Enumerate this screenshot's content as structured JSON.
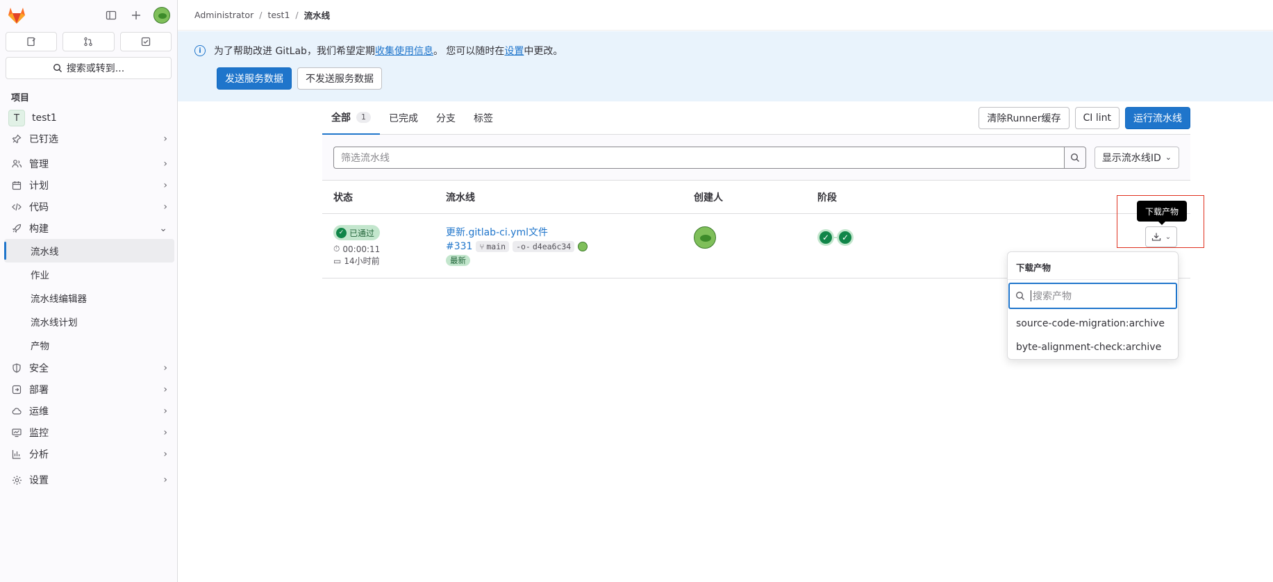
{
  "breadcrumb": [
    "Administrator",
    "test1",
    "流水线"
  ],
  "sidebar": {
    "search_label": "搜索或转到...",
    "section_title": "项目",
    "project_initial": "T",
    "project_name": "test1",
    "items": [
      {
        "label": "已钉选",
        "icon": "pin-icon"
      },
      {
        "label": "管理",
        "icon": "manage-icon"
      },
      {
        "label": "计划",
        "icon": "plan-icon"
      },
      {
        "label": "代码",
        "icon": "code-icon"
      },
      {
        "label": "构建",
        "icon": "rocket-icon"
      }
    ],
    "build_subitems": [
      "流水线",
      "作业",
      "流水线编辑器",
      "流水线计划",
      "产物"
    ],
    "items_after": [
      {
        "label": "安全",
        "icon": "shield-icon"
      },
      {
        "label": "部署",
        "icon": "deploy-icon"
      },
      {
        "label": "运维",
        "icon": "cloud-icon"
      },
      {
        "label": "监控",
        "icon": "monitor-icon"
      },
      {
        "label": "分析",
        "icon": "chart-icon"
      }
    ],
    "settings_label": "设置"
  },
  "banner": {
    "text_before": "为了帮助改进 GitLab，我们希望定期",
    "link1": "收集使用信息",
    "text_mid": "。 您可以随时在",
    "link2": "设置",
    "text_after": "中更改。",
    "send_button": "发送服务数据",
    "dont_send_button": "不发送服务数据"
  },
  "tabs": [
    {
      "label": "全部",
      "count": "1"
    },
    {
      "label": "已完成"
    },
    {
      "label": "分支"
    },
    {
      "label": "标签"
    }
  ],
  "actions": {
    "clear_cache": "清除Runner缓存",
    "ci_lint": "CI lint",
    "run_pipeline": "运行流水线"
  },
  "filter": {
    "placeholder": "筛选流水线",
    "id_dropdown": "显示流水线ID"
  },
  "table": {
    "headers": [
      "状态",
      "流水线",
      "创建人",
      "阶段"
    ],
    "row": {
      "status": "已通过",
      "duration": "00:00:11",
      "finished": "14小时前",
      "title": "更新.gitlab-ci.yml文件",
      "id": "#331",
      "branch": "main",
      "commit": "d4ea6c34",
      "tag": "最新"
    }
  },
  "artifacts": {
    "tooltip": "下载产物",
    "panel_title": "下载产物",
    "search_placeholder": "搜索产物",
    "items": [
      "source-code-migration:archive",
      "byte-alignment-check:archive"
    ]
  },
  "colors": {
    "primary": "#1f75cb",
    "success": "#108548",
    "highlight": "#e0301e"
  }
}
